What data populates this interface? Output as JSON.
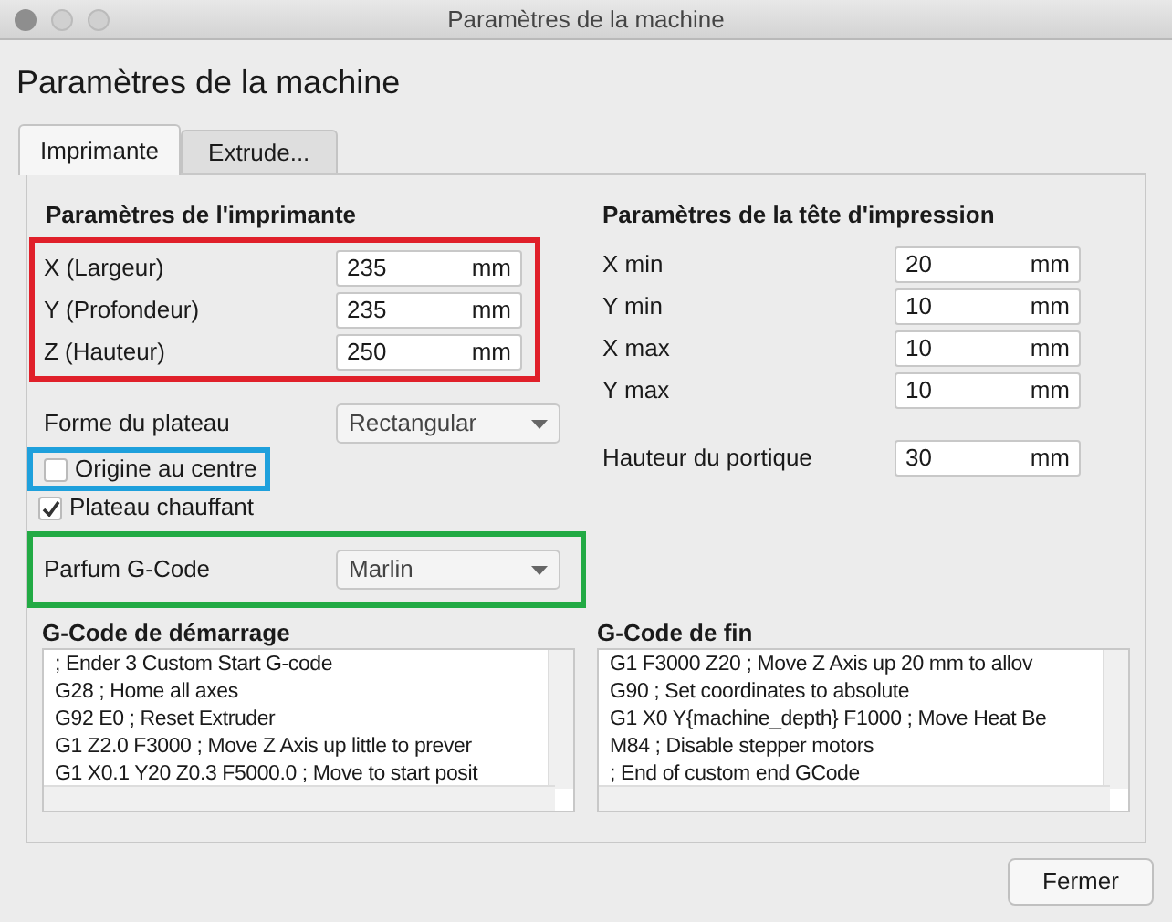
{
  "window": {
    "title": "Paramètres de la machine"
  },
  "heading": "Paramètres de la machine",
  "tabs": [
    {
      "label": "Imprimante",
      "selected": true
    },
    {
      "label": "Extrude...",
      "selected": false
    }
  ],
  "printer": {
    "title": "Paramètres de l'imprimante",
    "dimensions": {
      "color": "#e0202a",
      "fields": [
        {
          "label": "X (Largeur)",
          "value": "235",
          "unit": "mm"
        },
        {
          "label": "Y (Profondeur)",
          "value": "235",
          "unit": "mm"
        },
        {
          "label": "Z (Hauteur)",
          "value": "250",
          "unit": "mm"
        }
      ]
    },
    "bed_shape": {
      "label": "Forme du plateau",
      "value": "Rectangular"
    },
    "checkboxes": [
      {
        "label": "Origine au centre",
        "checked": false,
        "color": "#1ea0dc"
      },
      {
        "label": "Plateau chauffant",
        "checked": true
      }
    ],
    "gcode_flavor": {
      "label": "Parfum G-Code",
      "value": "Marlin",
      "color": "#22aa44"
    }
  },
  "head": {
    "title": "Paramètres de la tête d'impression",
    "fields": [
      {
        "label": "X min",
        "value": "20",
        "unit": "mm"
      },
      {
        "label": "Y min",
        "value": "10",
        "unit": "mm"
      },
      {
        "label": "X max",
        "value": "10",
        "unit": "mm"
      },
      {
        "label": "Y max",
        "value": "10",
        "unit": "mm"
      }
    ],
    "gantry": {
      "label": "Hauteur du portique",
      "value": "30",
      "unit": "mm"
    }
  },
  "start_gcode": {
    "title": "G-Code de démarrage",
    "lines": [
      "; Ender 3 Custom Start G-code",
      "G28 ; Home all axes",
      "G92 E0 ; Reset Extruder",
      "G1 Z2.0 F3000 ; Move Z Axis up little to prever",
      "G1 X0.1 Y20 Z0.3 F5000.0 ; Move to start posit"
    ]
  },
  "end_gcode": {
    "title": "G-Code de fin",
    "lines": [
      "G1 F3000 Z20 ; Move Z Axis up 20 mm to allov",
      "G90 ; Set coordinates to absolute",
      "G1 X0 Y{machine_depth} F1000 ; Move Heat Be",
      "M84 ; Disable stepper motors",
      "; End of custom end GCode"
    ]
  },
  "buttons": [
    {
      "label": "Fermer"
    }
  ]
}
